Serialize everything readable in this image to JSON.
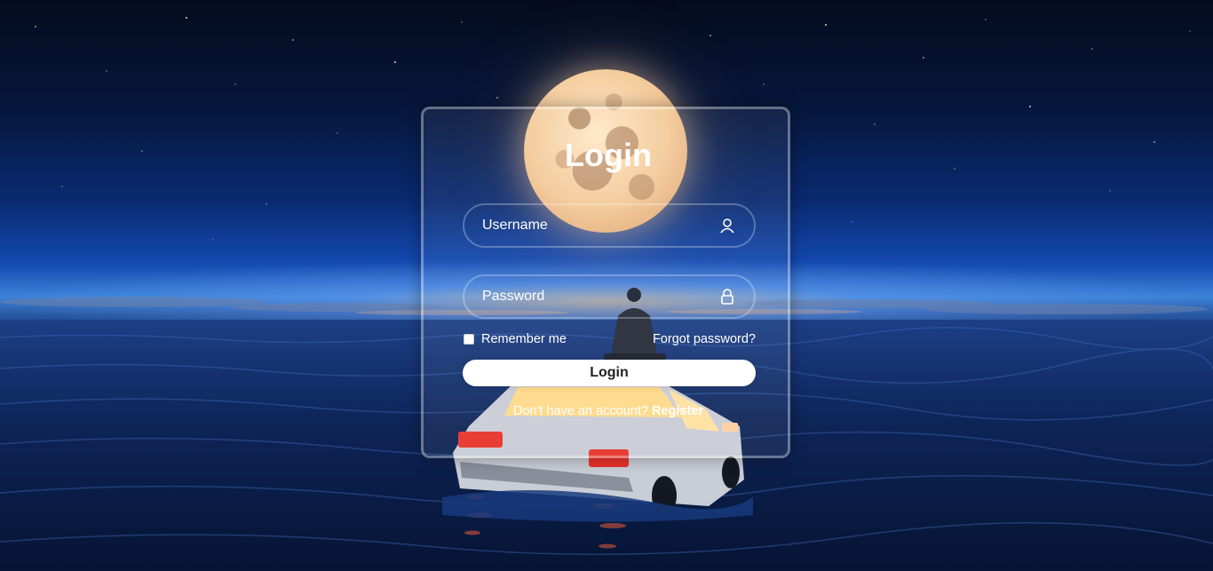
{
  "login_form": {
    "title": "Login",
    "username": {
      "placeholder": "Username",
      "value": "",
      "icon": "user-icon"
    },
    "password": {
      "placeholder": "Password",
      "value": "",
      "icon": "lock-icon"
    },
    "remember_me": {
      "label": "Remember me",
      "checked": false
    },
    "forgot_password_label": "Forgot password?",
    "submit_label": "Login",
    "register_prompt": "Don't have an account?",
    "register_label": "Register"
  },
  "colors": {
    "text": "#ffffff",
    "button_background": "#ffffff",
    "button_text": "#222222"
  }
}
